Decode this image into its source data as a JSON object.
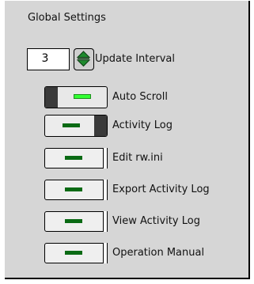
{
  "panel": {
    "title": "Global Settings"
  },
  "update_interval": {
    "value": "3",
    "label": "Update Interval"
  },
  "toggles": {
    "auto_scroll": {
      "label": "Auto Scroll",
      "state": "on"
    },
    "activity_log": {
      "label": "Activity Log",
      "state": "off"
    }
  },
  "buttons": {
    "edit_ini": "Edit rw.ini",
    "export_log": "Export Activity Log",
    "view_log": "View Activity Log",
    "manual": "Operation Manual"
  },
  "colors": {
    "panel_bg": "#d6d6d6",
    "led_on": "#33ff33",
    "led_off": "#0a6a14"
  }
}
